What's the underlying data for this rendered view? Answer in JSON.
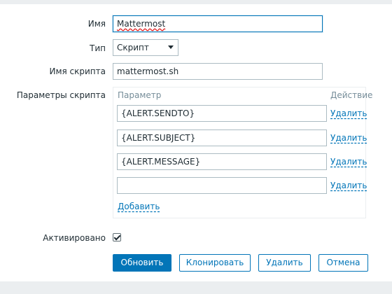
{
  "form": {
    "name_label": "Имя",
    "name_value": "Mattermost",
    "type_label": "Тип",
    "type_value": "Скрипт",
    "script_name_label": "Имя скрипта",
    "script_name_value": "mattermost.sh",
    "params_label": "Параметры скрипта",
    "params": {
      "header_param": "Параметр",
      "header_action": "Действие",
      "rows": [
        {
          "value": "{ALERT.SENDTO}",
          "action": "Удалить"
        },
        {
          "value": "{ALERT.SUBJECT}",
          "action": "Удалить"
        },
        {
          "value": "{ALERT.MESSAGE}",
          "action": "Удалить"
        },
        {
          "value": "",
          "action": "Удалить"
        }
      ],
      "add_label": "Добавить"
    },
    "enabled_label": "Активировано",
    "enabled_checked": true
  },
  "buttons": {
    "update": "Обновить",
    "clone": "Клонировать",
    "delete": "Удалить",
    "cancel": "Отмена"
  },
  "colors": {
    "accent": "#0275b8",
    "background": "#ebeef0"
  }
}
